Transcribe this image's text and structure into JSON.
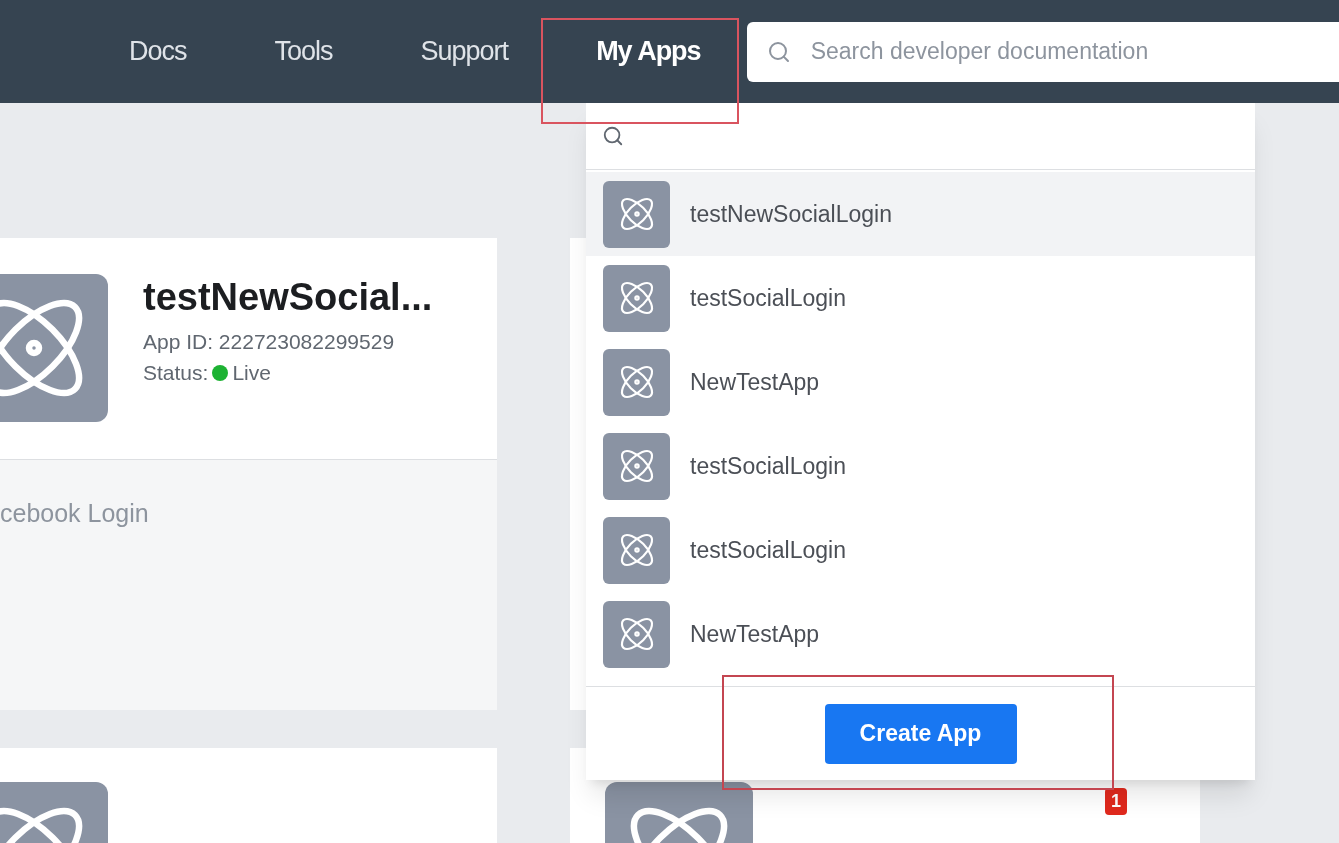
{
  "nav": {
    "items": [
      {
        "label": "Docs",
        "selected": false
      },
      {
        "label": "Tools",
        "selected": false
      },
      {
        "label": "Support",
        "selected": false
      },
      {
        "label": "My Apps",
        "selected": true
      }
    ],
    "search": {
      "placeholder": "Search developer documentation"
    }
  },
  "app_card": {
    "name": "testNewSocial...",
    "app_id": "App ID: 222723082299529",
    "status_label": "Status:",
    "status": {
      "label": "Live",
      "color": "#1db233"
    },
    "product": "cebook Login"
  },
  "side_card": {
    "badge": "1"
  },
  "apps_menu": {
    "apps": [
      {
        "name": "testNewSocialLogin",
        "selected": true
      },
      {
        "name": "testSocialLogin",
        "selected": false
      },
      {
        "name": "NewTestApp",
        "selected": false
      },
      {
        "name": "testSocialLogin",
        "selected": false
      },
      {
        "name": "testSocialLogin",
        "selected": false
      },
      {
        "name": "NewTestApp",
        "selected": false
      }
    ],
    "button": "Create App"
  }
}
